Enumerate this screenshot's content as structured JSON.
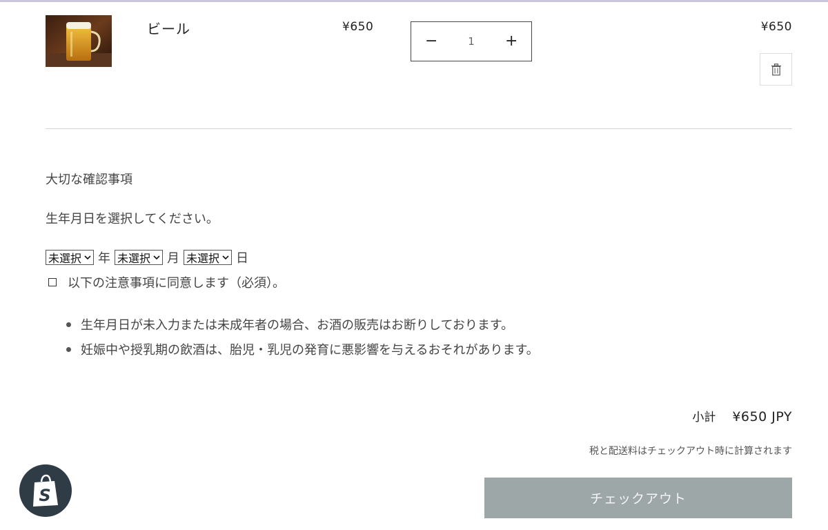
{
  "cart": {
    "item": {
      "name": "ビール",
      "image_alt": "beer-mug-photo",
      "unit_price": "¥650",
      "quantity": "1",
      "line_total": "¥650",
      "decrease_symbol": "−",
      "increase_symbol": "+",
      "delete_icon": "trash-icon"
    }
  },
  "notice": {
    "title": "大切な確認事項",
    "dob_prompt": "生年月日を選択してください。",
    "dob": {
      "year_value": "未選択",
      "year_unit": "年",
      "month_value": "未選択",
      "month_unit": "月",
      "day_value": "未選択",
      "day_unit": "日"
    },
    "agree_label": "以下の注意事項に同意します（必須）。",
    "items": [
      "生年月日が未入力または未成年者の場合、お酒の販売はお断りしております。",
      "妊娠中や授乳期の飲酒は、胎児・乳児の発育に悪影響を与えるおそれがあります。"
    ]
  },
  "summary": {
    "subtotal_label": "小計",
    "subtotal_value": "¥650 JPY",
    "tax_note": "税と配送料はチェックアウト時に計算されます",
    "checkout_label": "チェックアウト"
  },
  "badge": {
    "icon": "shopify-bag-icon"
  },
  "colors": {
    "top_border": "#c9c6dd",
    "checkout_bg": "#9ea7a8",
    "badge_bg": "#2f3b45"
  }
}
